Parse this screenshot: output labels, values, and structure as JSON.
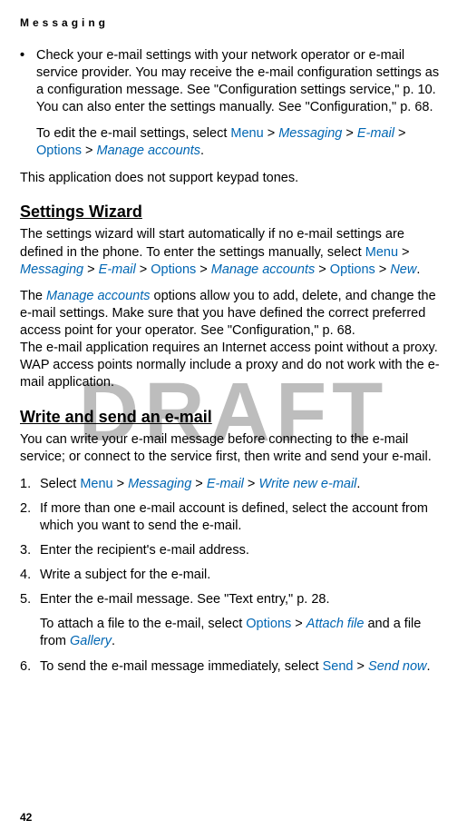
{
  "runningHeader": "Messaging",
  "watermark": "DRAFT",
  "pageNumber": "42",
  "bullet": {
    "marker": "•",
    "text": "Check your e-mail settings with your network operator or e-mail service provider. You may receive the e-mail configuration settings as a configuration message. See \"Configuration settings service,\" p. 10. You can also enter the settings manually. See \"Configuration,\" p. 68."
  },
  "editIntro": {
    "lead": "To edit the e-mail settings, select ",
    "menu": "Menu",
    "gt1": " > ",
    "messaging": "Messaging",
    "gt2": " > ",
    "email": "E-mail",
    "gt3": " > ",
    "options": "Options",
    "gt4": "  > ",
    "manage": "Manage accounts",
    "end": "."
  },
  "noKeypad": "This application does not support keypad tones.",
  "wizard": {
    "heading": "Settings Wizard",
    "p1_lead": "The settings wizard will start automatically if no e-mail settings are defined in the phone. To enter the settings manually, select ",
    "p1_menu": "Menu",
    "p1_gt1": " > ",
    "p1_messaging": "Messaging",
    "p1_gt2": " > ",
    "p1_email": "E-mail",
    "p1_gt3": " > ",
    "p1_options1": "Options",
    "p1_gt4": " > ",
    "p1_manage": "Manage accounts",
    "p1_gt5": " > ",
    "p1_options2": "Options",
    "p1_gt6": " > ",
    "p1_new": "New",
    "p1_end": ".",
    "p2_lead": "The ",
    "p2_manage": "Manage accounts",
    "p2_rest": " options allow you to add, delete, and change the e-mail settings. Make sure that you have defined the correct preferred access point for your operator. See \"Configuration,\" p. 68.",
    "p3": "The e-mail application requires an Internet access point without a proxy. WAP access points normally include a proxy and do not work with the e-mail application."
  },
  "write": {
    "heading": "Write and send an e-mail",
    "intro": "You can write your e-mail message before connecting to the e-mail service; or connect to the service first, then write and send your e-mail.",
    "item1_num": "1.",
    "item1_lead": "Select ",
    "item1_menu": "Menu",
    "item1_gt1": " > ",
    "item1_messaging": "Messaging",
    "item1_gt2": " > ",
    "item1_email": "E-mail",
    "item1_gt3": " > ",
    "item1_write": "Write new e-mail",
    "item1_end": ".",
    "item2_num": "2.",
    "item2_text": "If more than one e-mail account is defined, select the account from which you want to send the e-mail.",
    "item3_num": "3.",
    "item3_text": "Enter the recipient's e-mail address.",
    "item4_num": "4.",
    "item4_text": "Write a subject for the e-mail.",
    "item5_num": "5.",
    "item5_text": "Enter the e-mail message. See \"Text entry,\" p. 28.",
    "item5b_lead": "To attach a file to the e-mail, select ",
    "item5b_options": "Options",
    "item5b_gt": " > ",
    "item5b_attach": "Attach file",
    "item5b_mid": " and a file from ",
    "item5b_gallery": "Gallery",
    "item5b_end": ".",
    "item6_num": "6.",
    "item6_lead": "To send the e-mail message immediately, select ",
    "item6_send": "Send",
    "item6_gt": " > ",
    "item6_sendnow": "Send now",
    "item6_end": "."
  }
}
